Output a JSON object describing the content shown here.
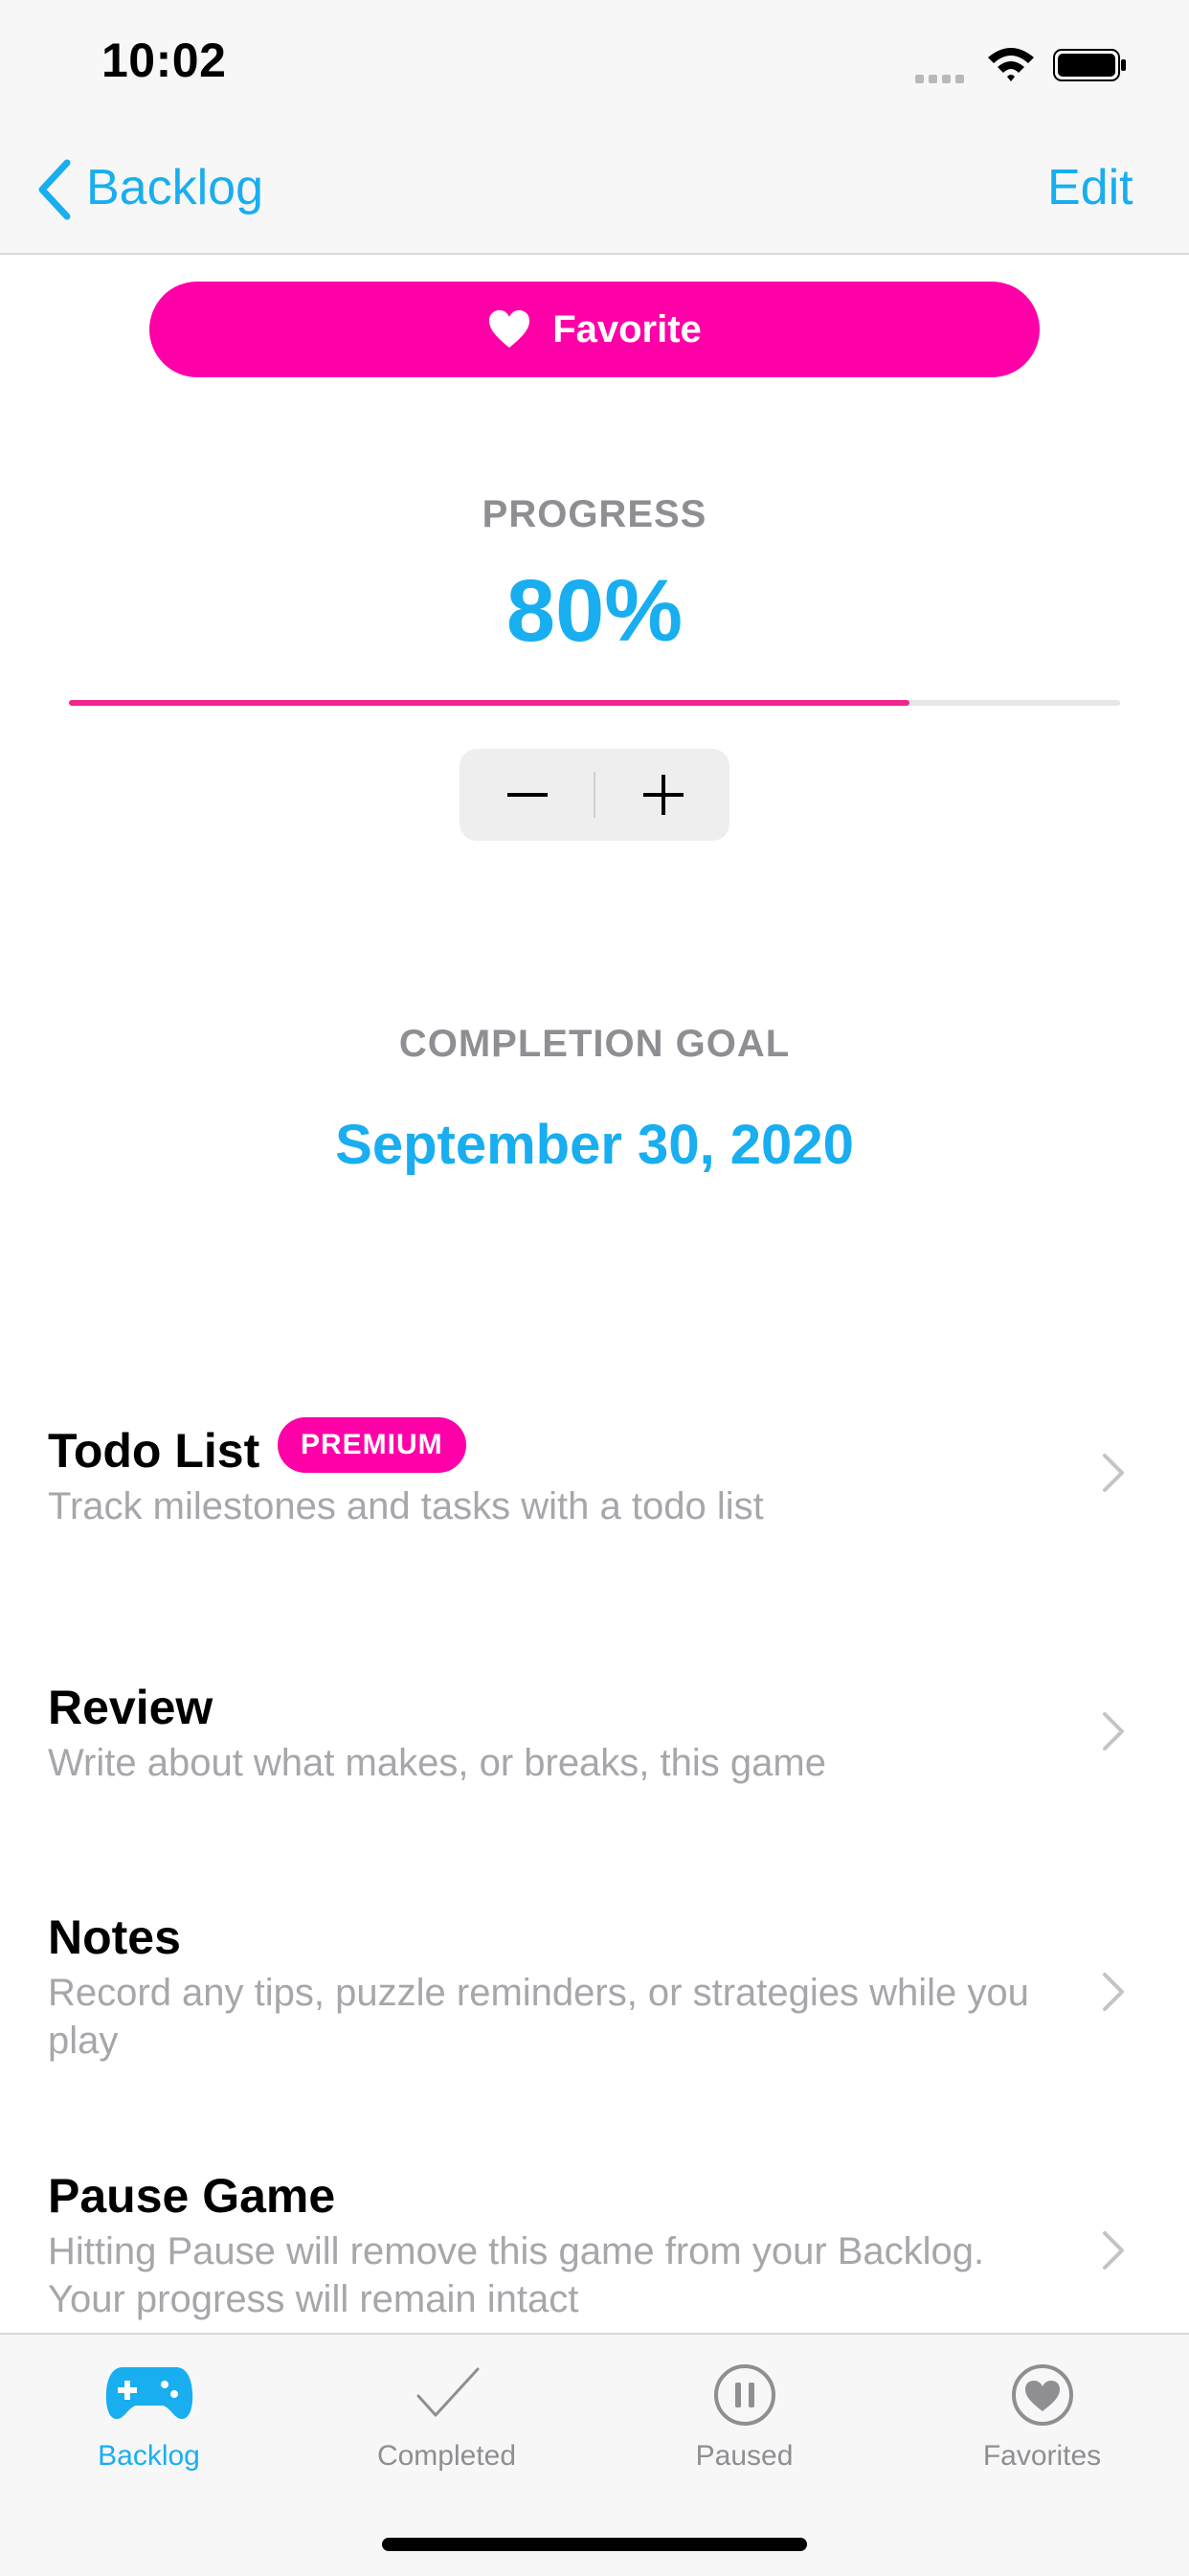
{
  "status_bar": {
    "time": "10:02"
  },
  "nav": {
    "back_label": "Backlog",
    "edit_label": "Edit"
  },
  "favorite": {
    "label": "Favorite"
  },
  "progress": {
    "label": "PROGRESS",
    "value_text": "80%",
    "value": 80
  },
  "completion_goal": {
    "label": "COMPLETION GOAL",
    "date": "September 30, 2020"
  },
  "rows": [
    {
      "title": "Todo List",
      "badge": "PREMIUM",
      "subtitle": "Track milestones and tasks with a todo list"
    },
    {
      "title": "Review",
      "subtitle": "Write about what makes, or breaks, this game"
    },
    {
      "title": "Notes",
      "subtitle": "Record any tips, puzzle reminders, or strategies while you play"
    },
    {
      "title": "Pause Game",
      "subtitle": "Hitting Pause will remove this game from your Backlog. Your progress will remain intact"
    }
  ],
  "tabs": [
    {
      "label": "Backlog",
      "icon": "gamepad-icon",
      "active": true
    },
    {
      "label": "Completed",
      "icon": "checkmark-icon",
      "active": false
    },
    {
      "label": "Paused",
      "icon": "pause-circle-icon",
      "active": false
    },
    {
      "label": "Favorites",
      "icon": "heart-circle-icon",
      "active": false
    }
  ],
  "colors": {
    "accent": "#18aef0",
    "brand_pink": "#ff00a8",
    "progress_fill": "#f0268f"
  }
}
